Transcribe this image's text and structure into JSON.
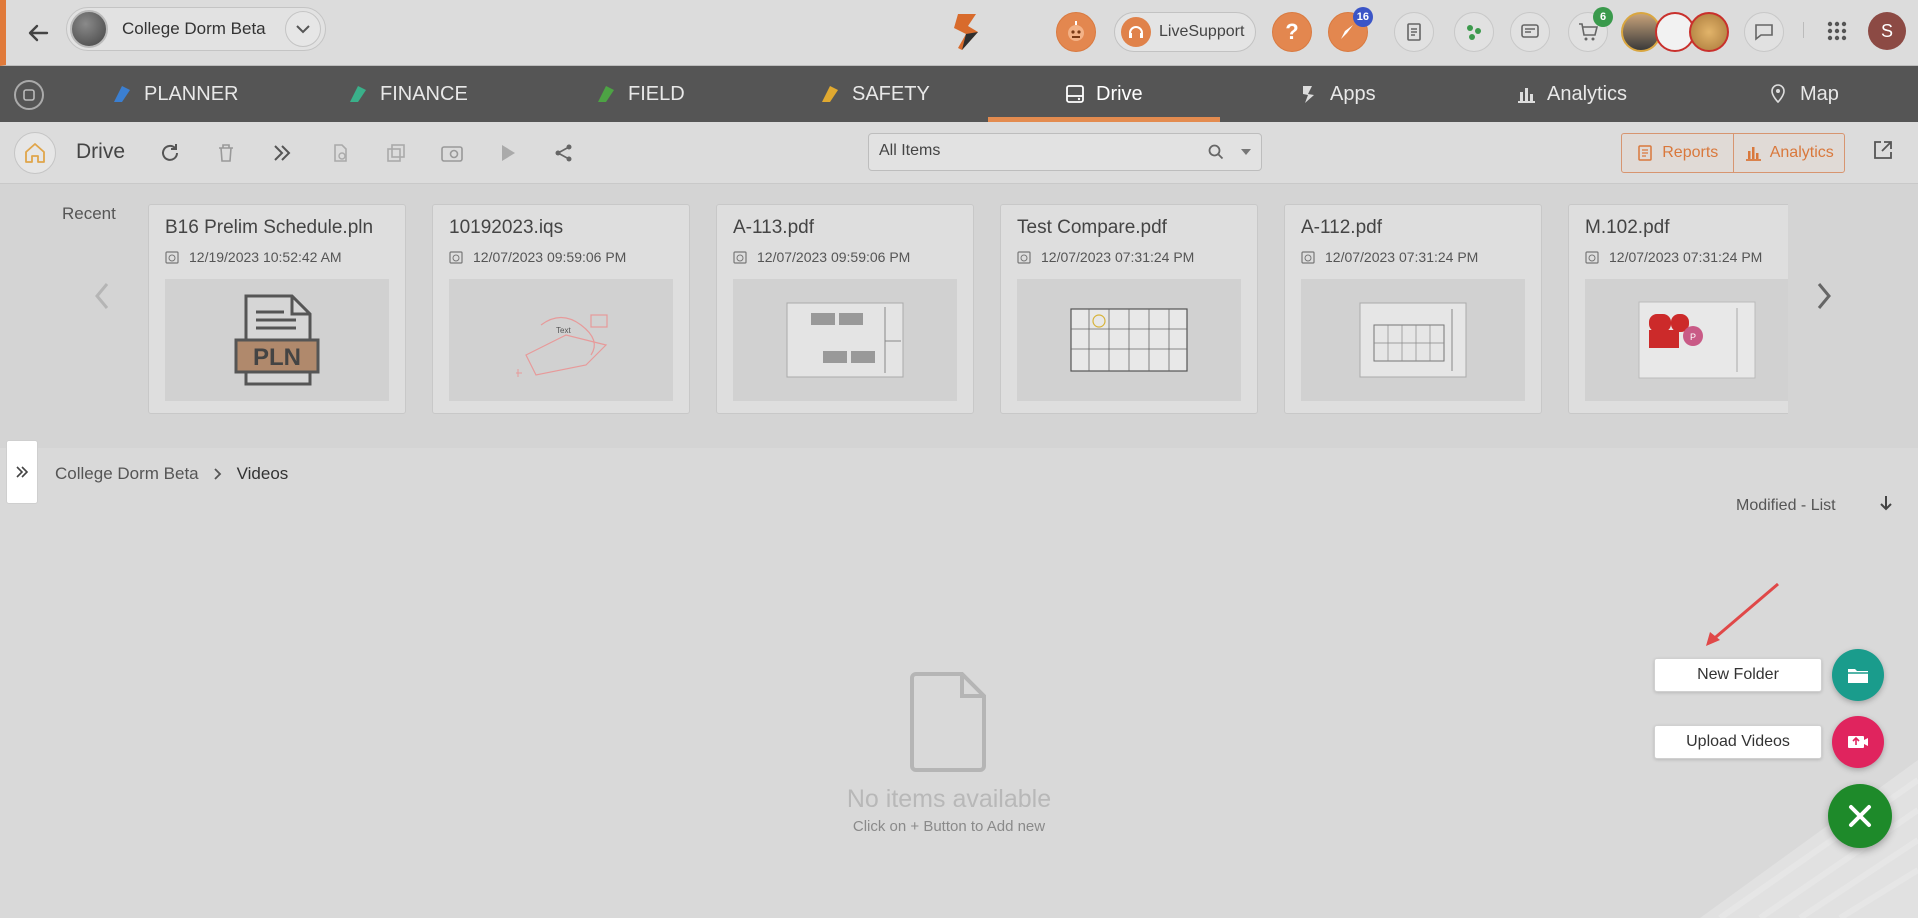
{
  "project": {
    "name": "College Dorm Beta"
  },
  "topbar": {
    "live_support_label": "LiveSupport",
    "notifications_badge": "16",
    "cart_badge": "6",
    "profile_initial": "S"
  },
  "nav": {
    "items": [
      {
        "label": "PLANNER",
        "icon": "planner-icon"
      },
      {
        "label": "FINANCE",
        "icon": "finance-icon"
      },
      {
        "label": "FIELD",
        "icon": "field-icon"
      },
      {
        "label": "SAFETY",
        "icon": "safety-icon"
      },
      {
        "label": "Drive",
        "icon": "drive-icon",
        "active": true
      },
      {
        "label": "Apps",
        "icon": "apps-icon"
      },
      {
        "label": "Analytics",
        "icon": "analytics-icon"
      },
      {
        "label": "Map",
        "icon": "map-icon"
      }
    ]
  },
  "toolbar": {
    "title": "Drive",
    "search_value": "All Items",
    "reports_label": "Reports",
    "analytics_label": "Analytics"
  },
  "recent": {
    "label": "Recent",
    "items": [
      {
        "name": "B16 Prelim Schedule.pln",
        "date": "12/19/2023 10:52:42 AM"
      },
      {
        "name": "10192023.iqs",
        "date": "12/07/2023 09:59:06 PM"
      },
      {
        "name": "A-113.pdf",
        "date": "12/07/2023 09:59:06 PM"
      },
      {
        "name": "Test Compare.pdf",
        "date": "12/07/2023 07:31:24 PM"
      },
      {
        "name": "A-112.pdf",
        "date": "12/07/2023 07:31:24 PM"
      },
      {
        "name": "M.102.pdf",
        "date": "12/07/2023 07:31:24 PM"
      }
    ],
    "pln_thumb_text": "PLN",
    "iqs_thumb_text": "Text",
    "m102_thumb_text": "P"
  },
  "breadcrumb": {
    "root": "College Dorm Beta",
    "current": "Videos"
  },
  "sort": {
    "label": "Modified - List"
  },
  "empty": {
    "title": "No items available",
    "subtitle": "Click on + Button to Add new"
  },
  "fab": {
    "new_folder_label": "New Folder",
    "upload_videos_label": "Upload Videos",
    "new_folder_color": "#1a9c8c",
    "upload_color": "#e0245e",
    "main_color": "#1e8a2a"
  },
  "colors": {
    "accent": "#e38b4f",
    "nav_bg": "#555555"
  }
}
